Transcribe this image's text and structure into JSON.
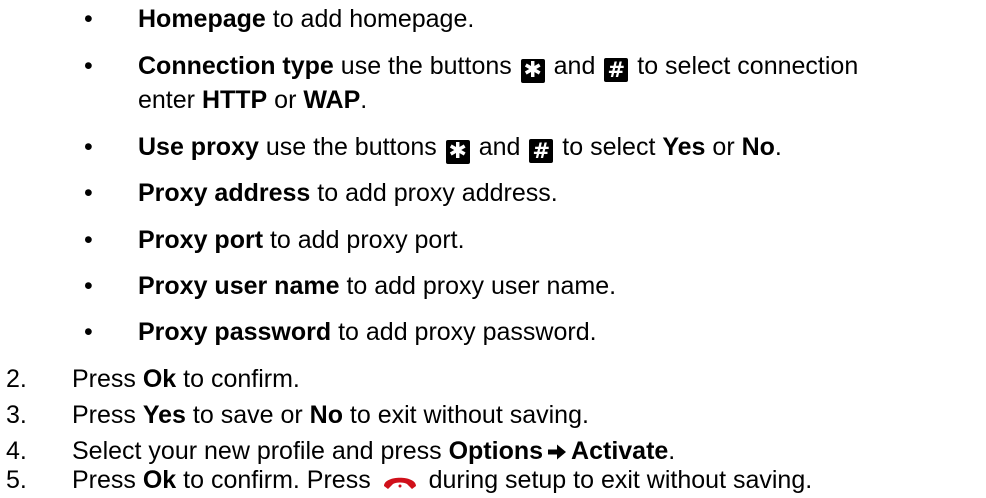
{
  "bullets": {
    "homepage": {
      "term": "Homepage",
      "rest": " to add homepage."
    },
    "connection": {
      "term": "Connection type",
      "pre": " use the buttons ",
      "and": " and ",
      "post": " to select connection",
      "line2_pre": "enter ",
      "opt1": "HTTP",
      "or": " or ",
      "opt2": "WAP",
      "end": "."
    },
    "proxy": {
      "term": "Use proxy",
      "pre": " use the buttons ",
      "and": " and ",
      "post": " to select ",
      "opt1": "Yes",
      "or": " or ",
      "opt2": "No",
      "end": "."
    },
    "proxy_address": {
      "term": "Proxy address",
      "rest": " to add proxy address."
    },
    "proxy_port": {
      "term": "Proxy port",
      "rest": " to add proxy port."
    },
    "proxy_user": {
      "term": "Proxy user name",
      "rest": " to add proxy user name."
    },
    "proxy_password": {
      "term": "Proxy password",
      "rest": " to add proxy password."
    }
  },
  "keys": {
    "star": "✱",
    "hash": "#"
  },
  "bullet_char": "•",
  "steps": {
    "s2": {
      "num": "2.",
      "pre": "Press ",
      "key": "Ok",
      "post": " to confirm."
    },
    "s3": {
      "num": "3.",
      "pre": "Press ",
      "key1": "Yes",
      "mid": " to save or ",
      "key2": "No",
      "post": " to exit without saving."
    },
    "s4": {
      "num": "4.",
      "pre": "Select your new profile and press ",
      "key1": "Options",
      "key2": "Activate",
      "end": "."
    },
    "s5": {
      "num": "5.",
      "pre": "Press ",
      "key": "Ok",
      "mid": " to confirm. Press ",
      "post": " during setup to exit without saving."
    }
  },
  "colors": {
    "end_call_icon": "#d0101a",
    "key_bg": "#000000"
  },
  "icons": {
    "arrow": "right-arrow-icon",
    "end_call": "end-call-icon"
  }
}
